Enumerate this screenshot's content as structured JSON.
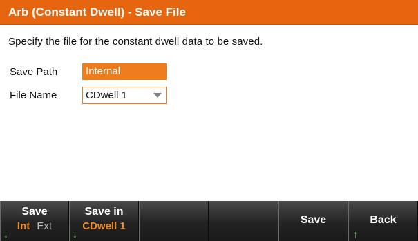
{
  "title": "Arb (Constant Dwell) - Save File",
  "description": "Specify the file for the constant dwell data to be saved.",
  "fields": {
    "save_path_label": "Save Path",
    "save_path_value": "Internal",
    "file_name_label": "File Name",
    "file_name_value": "CDwell 1"
  },
  "softkeys": {
    "save_loc_label": "Save",
    "save_loc_int": "Int",
    "save_loc_ext": "Ext",
    "save_in_label": "Save in",
    "save_in_value": "CDwell 1",
    "save_label": "Save",
    "back_label": "Back"
  },
  "icons": {
    "down_arrow": "↓",
    "up_arrow": "↑"
  },
  "colors": {
    "accent": "#e8650f",
    "field_highlight": "#ef7d1e",
    "softkey_selected": "#f08a24",
    "arrow": "#6fd36f"
  }
}
